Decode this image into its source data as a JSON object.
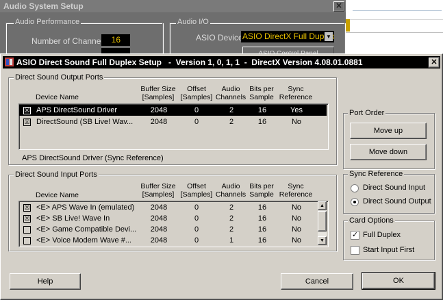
{
  "bg_window": {
    "title": "Audio System Setup",
    "close": "✕",
    "audio_performance": "Audio Performance",
    "num_channels_label": "Number of Channels",
    "num_channels_value": "16",
    "audio_io": "Audio I/O",
    "asio_device_label": "ASIO Device",
    "asio_device_value": "ASIO DirectX Full Duplex",
    "asio_button_partial": "ASIO Control Panel"
  },
  "dialog": {
    "title": "ASIO Direct Sound Full Duplex Setup   -  Version 1, 0, 1, 1  -  DirectX Version 4.08.01.0881",
    "close": "✕"
  },
  "output_ports": {
    "legend": "Direct Sound Output Ports",
    "headers": {
      "device": "Device Name",
      "buffer": [
        "Buffer Size",
        "[Samples]"
      ],
      "offset": [
        "Offset",
        "[Samples]"
      ],
      "channels": [
        "Audio",
        "Channels"
      ],
      "bits": [
        "Bits per",
        "Sample"
      ],
      "sync": [
        "Sync",
        "Reference"
      ]
    },
    "rows": [
      {
        "checked": "☒",
        "name": "APS DirectSound Driver",
        "buffer": "2048",
        "offset": "0",
        "channels": "2",
        "bits": "16",
        "sync": "Yes"
      },
      {
        "checked": "☒",
        "name": "DirectSound (SB Live! Wav...",
        "buffer": "2048",
        "offset": "0",
        "channels": "2",
        "bits": "16",
        "sync": "No"
      }
    ],
    "status": "APS DirectSound Driver  (Sync Reference)"
  },
  "input_ports": {
    "legend": "Direct Sound Input Ports",
    "headers": {
      "device": "Device Name",
      "buffer": [
        "Buffer Size",
        "[Samples]"
      ],
      "offset": [
        "Offset",
        "[Samples]"
      ],
      "channels": [
        "Audio",
        "Channels"
      ],
      "bits": [
        "Bits per",
        "Sample"
      ],
      "sync": [
        "Sync",
        "Reference"
      ]
    },
    "rows": [
      {
        "checked": "☒",
        "name": "<E> APS Wave In (emulated)",
        "buffer": "2048",
        "offset": "0",
        "channels": "2",
        "bits": "16",
        "sync": "No"
      },
      {
        "checked": "☒",
        "name": "<E> SB Live! Wave In",
        "buffer": "2048",
        "offset": "0",
        "channels": "2",
        "bits": "16",
        "sync": "No"
      },
      {
        "checked": "",
        "name": "<E> Game Compatible Devi...",
        "buffer": "2048",
        "offset": "0",
        "channels": "2",
        "bits": "16",
        "sync": "No"
      },
      {
        "checked": "",
        "name": "<E> Voice Modem Wave #...",
        "buffer": "2048",
        "offset": "0",
        "channels": "1",
        "bits": "16",
        "sync": "No"
      }
    ]
  },
  "port_order": {
    "legend": "Port Order",
    "move_up": "Move up",
    "move_down": "Move down"
  },
  "sync_reference": {
    "legend": "Sync Reference",
    "options": [
      {
        "label": "Direct Sound Input",
        "selected": false
      },
      {
        "label": "Direct Sound Output",
        "selected": true
      }
    ]
  },
  "card_options": {
    "legend": "Card Options",
    "full_duplex": {
      "label": "Full Duplex",
      "mark": "✓"
    },
    "start_input_first": {
      "label": "Start Input First",
      "mark": ""
    }
  },
  "buttons": {
    "help": "Help",
    "cancel": "Cancel",
    "ok": "OK"
  },
  "scroll": {
    "up": "▲",
    "down": "▼"
  },
  "colors": {
    "dialog_bg": "#d4d0c8",
    "selection": "#000000",
    "titlebar": "#000000"
  }
}
